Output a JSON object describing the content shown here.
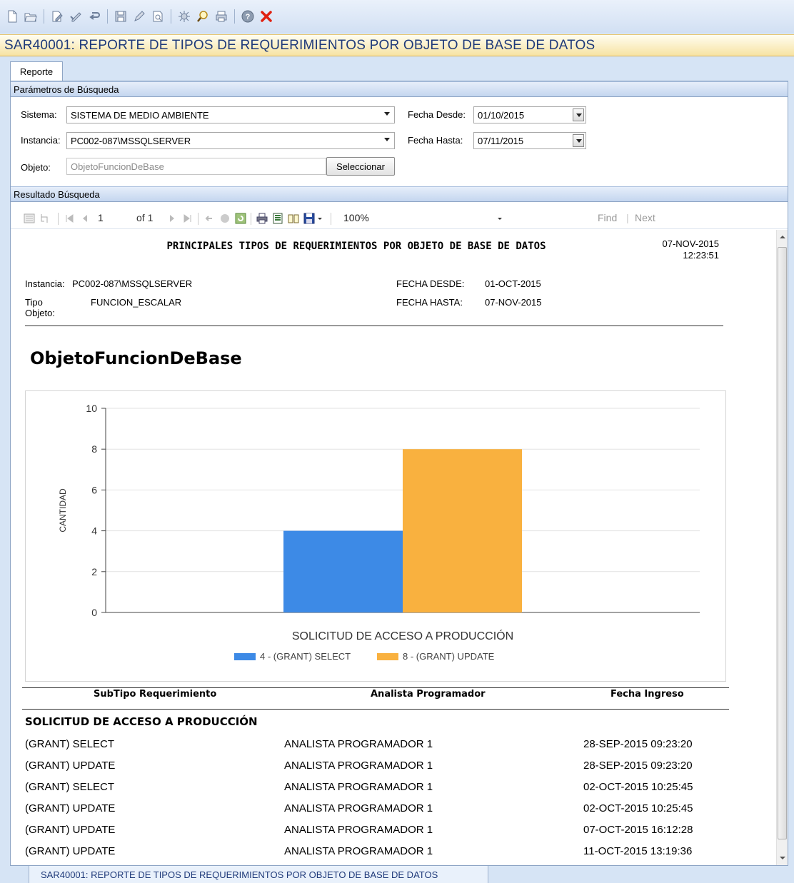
{
  "toolbar": {
    "icons": [
      "new-icon",
      "open-icon",
      "edit-icon",
      "approve-icon",
      "undo-icon",
      "save-icon",
      "pencil-icon",
      "preview-icon",
      "process-icon",
      "search-icon",
      "print-icon",
      "help-icon",
      "close-icon"
    ]
  },
  "window": {
    "title": "SAR40001: REPORTE DE TIPOS DE REQUERIMIENTOS POR OBJETO DE BASE DE DATOS"
  },
  "tabs": [
    {
      "label": "Reporte"
    }
  ],
  "search": {
    "section_title": "Parámetros de Búsqueda",
    "sistema_label": "Sistema:",
    "sistema_value": "SISTEMA DE MEDIO AMBIENTE",
    "instancia_label": "Instancia:",
    "instancia_value": "PC002-087\\MSSQLSERVER",
    "objeto_label": "Objeto:",
    "objeto_placeholder": "ObjetoFuncionDeBase",
    "select_button": "Seleccionar",
    "fecha_desde_label": "Fecha Desde:",
    "fecha_desde_value": "01/10/2015",
    "fecha_hasta_label": "Fecha Hasta:",
    "fecha_hasta_value": "07/11/2015"
  },
  "results": {
    "section_title": "Resultado Búsqueda"
  },
  "viewer": {
    "page_current": "1",
    "page_total": "of 1",
    "zoom": "100%",
    "find": "Find",
    "next": "Next"
  },
  "report": {
    "title": "PRINCIPALES TIPOS DE REQUERIMIENTOS POR OBJETO DE BASE DE DATOS",
    "date": "07-NOV-2015",
    "time": "12:23:51",
    "instancia_label": "Instancia:",
    "instancia_value": "PC002-087\\MSSQLSERVER",
    "tipo_label": "Tipo Objeto:",
    "tipo_value": "FUNCION_ESCALAR",
    "fecha_desde_label": "FECHA DESDE:",
    "fecha_desde_value": "01-OCT-2015",
    "fecha_hasta_label": "FECHA HASTA:",
    "fecha_hasta_value": "07-NOV-2015",
    "object_name": "ObjetoFuncionDeBase",
    "columns": [
      "SubTipo Requerimiento",
      "Analista Programador",
      "Fecha Ingreso"
    ],
    "group": "SOLICITUD DE ACCESO A PRODUCCIÓN",
    "rows": [
      {
        "subtipo": "(GRANT) SELECT",
        "analista": "ANALISTA PROGRAMADOR 1",
        "fecha": "28-SEP-2015 09:23:20"
      },
      {
        "subtipo": "(GRANT) UPDATE",
        "analista": "ANALISTA PROGRAMADOR 1",
        "fecha": "28-SEP-2015 09:23:20"
      },
      {
        "subtipo": "(GRANT) SELECT",
        "analista": "ANALISTA PROGRAMADOR 1",
        "fecha": "02-OCT-2015 10:25:45"
      },
      {
        "subtipo": "(GRANT) UPDATE",
        "analista": "ANALISTA PROGRAMADOR 1",
        "fecha": "02-OCT-2015 10:25:45"
      },
      {
        "subtipo": "(GRANT) UPDATE",
        "analista": "ANALISTA PROGRAMADOR 1",
        "fecha": "07-OCT-2015 16:12:28"
      },
      {
        "subtipo": "(GRANT) UPDATE",
        "analista": "ANALISTA PROGRAMADOR 1",
        "fecha": "11-OCT-2015 13:19:36"
      }
    ]
  },
  "chart_data": {
    "type": "bar",
    "categories": [
      "SOLICITUD DE ACCESO A PRODUCCIÓN"
    ],
    "series": [
      {
        "name": "4 - (GRANT) SELECT",
        "values": [
          4
        ],
        "color": "#3d8ae6"
      },
      {
        "name": "8 - (GRANT) UPDATE",
        "values": [
          8
        ],
        "color": "#f9b13f"
      }
    ],
    "ylabel": "CANTIDAD",
    "yticks": [
      0,
      2,
      4,
      6,
      8,
      10
    ],
    "ylim": [
      0,
      10
    ],
    "grid": true,
    "legend": "bottom"
  },
  "status": {
    "tab_label": "SAR40001: REPORTE DE TIPOS DE REQUERIMIENTOS POR OBJETO DE BASE DE DATOS"
  }
}
